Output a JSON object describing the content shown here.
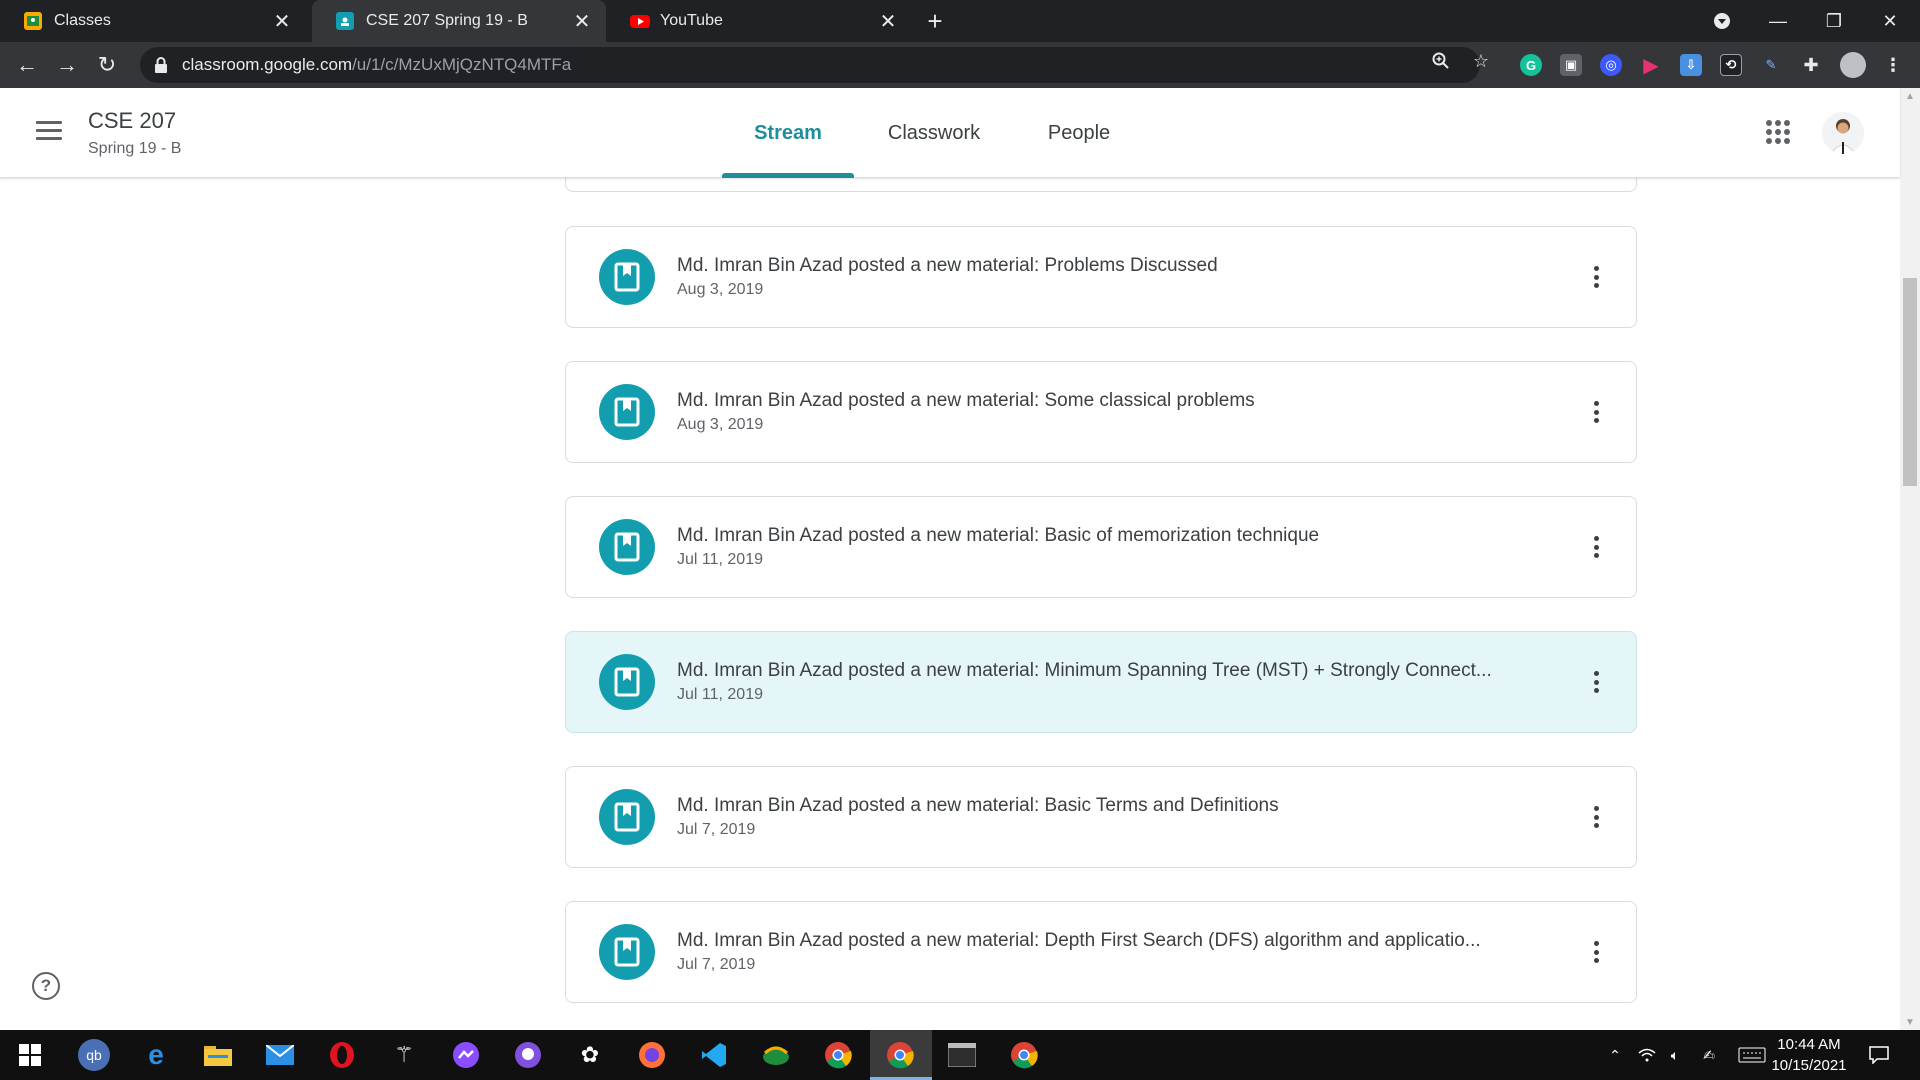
{
  "browser": {
    "tabs": [
      {
        "label": "Classes",
        "active": false
      },
      {
        "label": "CSE 207 Spring 19 - B",
        "active": true
      },
      {
        "label": "YouTube",
        "active": false
      }
    ],
    "url_host": "classroom.google.com",
    "url_path": "/u/1/c/MzUxMjQzNTQ4MTFa"
  },
  "classroom": {
    "course_title": "CSE 207",
    "course_subtitle": "Spring 19 - B",
    "nav_tabs": [
      {
        "label": "Stream",
        "active": true
      },
      {
        "label": "Classwork",
        "active": false
      },
      {
        "label": "People",
        "active": false
      }
    ]
  },
  "stream": {
    "posts": [
      {
        "title": "Md. Imran Bin Azad posted a new material: Problems Discussed",
        "date": "Aug 3, 2019",
        "highlighted": false
      },
      {
        "title": "Md. Imran Bin Azad posted a new material: Some classical problems",
        "date": "Aug 3, 2019",
        "highlighted": false
      },
      {
        "title": "Md. Imran Bin Azad posted a new material: Basic of memorization technique",
        "date": "Jul 11, 2019",
        "highlighted": false
      },
      {
        "title": "Md. Imran Bin Azad posted a new material: Minimum Spanning Tree (MST) + Strongly Connect...",
        "date": "Jul 11, 2019",
        "highlighted": true
      },
      {
        "title": "Md. Imran Bin Azad posted a new material: Basic Terms and Definitions",
        "date": "Jul 7, 2019",
        "highlighted": false
      },
      {
        "title": "Md. Imran Bin Azad posted a new material: Depth First Search (DFS) algorithm and applicatio...",
        "date": "Jul 7, 2019",
        "highlighted": false
      }
    ]
  },
  "help_glyph": "?",
  "taskbar": {
    "time": "10:44 AM",
    "date": "10/15/2021"
  },
  "colors": {
    "accent": "#1e8e9e",
    "material_icon_bg": "#129eaf",
    "highlight_bg": "#e4f6f8"
  }
}
